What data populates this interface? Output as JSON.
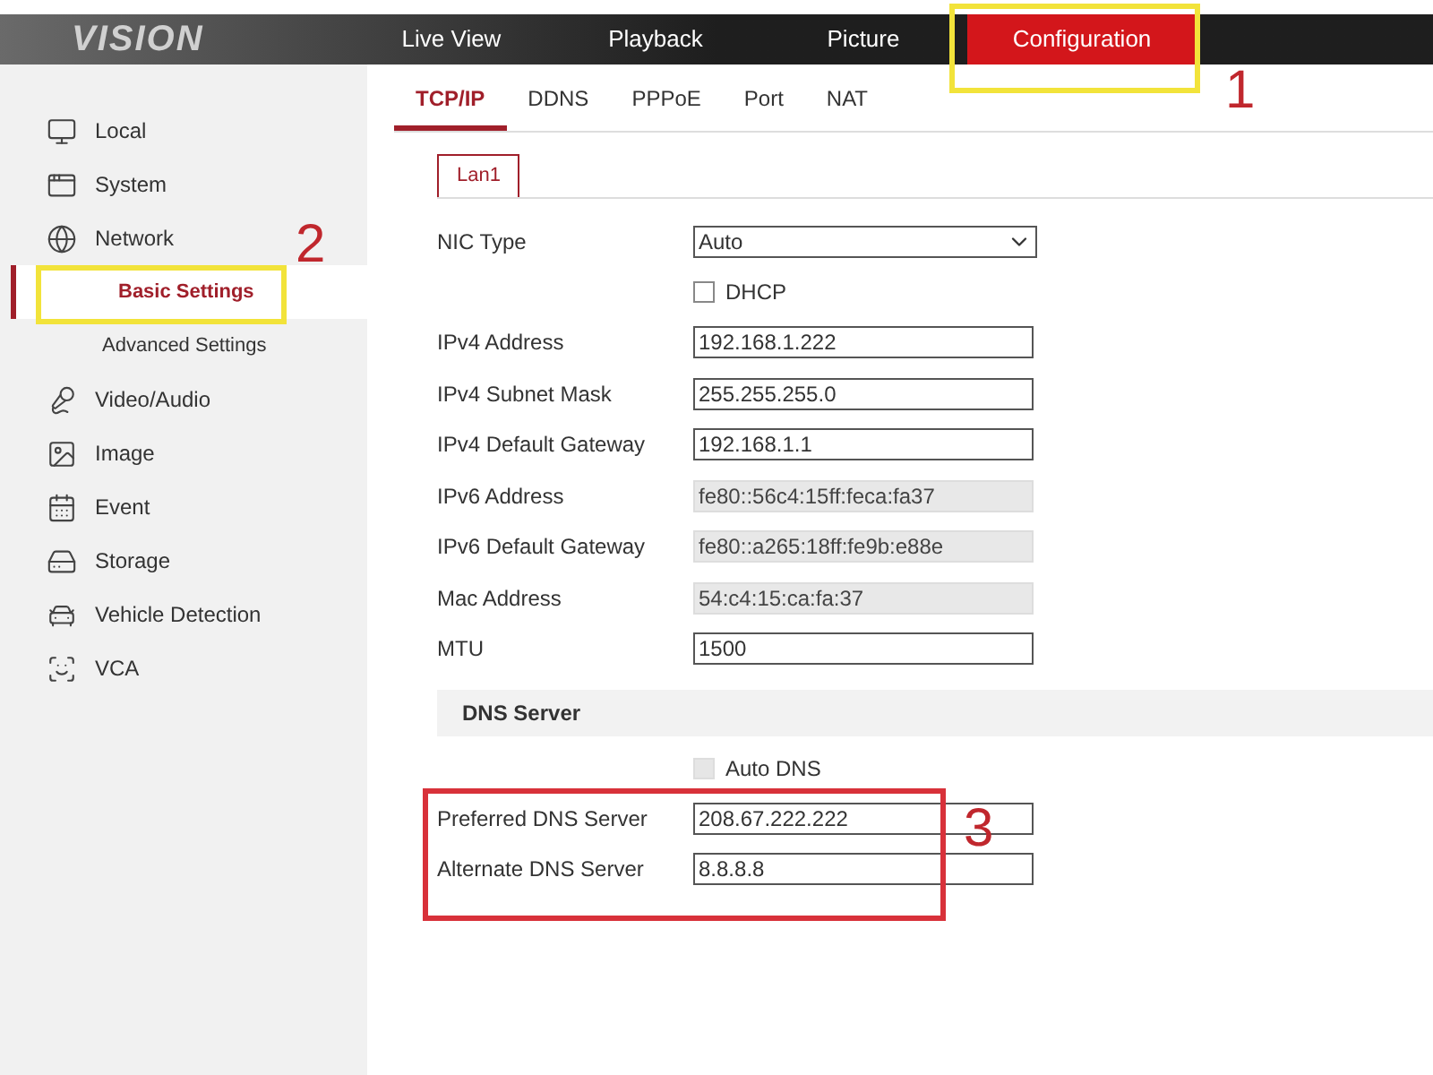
{
  "header": {
    "logo_text": "VISION",
    "nav": [
      {
        "label": "Live View",
        "selected": false
      },
      {
        "label": "Playback",
        "selected": false
      },
      {
        "label": "Picture",
        "selected": false
      },
      {
        "label": "Configuration",
        "selected": true
      }
    ]
  },
  "sidebar": {
    "items": [
      {
        "label": "Local",
        "selected": false
      },
      {
        "label": "System",
        "selected": false
      },
      {
        "label": "Network",
        "selected": false,
        "children": [
          {
            "label": "Basic Settings",
            "selected": true
          },
          {
            "label": "Advanced Settings",
            "selected": false
          }
        ]
      },
      {
        "label": "Video/Audio",
        "selected": false
      },
      {
        "label": "Image",
        "selected": false
      },
      {
        "label": "Event",
        "selected": false
      },
      {
        "label": "Storage",
        "selected": false
      },
      {
        "label": "Vehicle Detection",
        "selected": false
      },
      {
        "label": "VCA",
        "selected": false
      }
    ]
  },
  "tabs": [
    {
      "label": "TCP/IP",
      "selected": true
    },
    {
      "label": "DDNS",
      "selected": false
    },
    {
      "label": "PPPoE",
      "selected": false
    },
    {
      "label": "Port",
      "selected": false
    },
    {
      "label": "NAT",
      "selected": false
    }
  ],
  "subtabs": [
    {
      "label": "Lan1",
      "selected": true
    }
  ],
  "form": {
    "fields": [
      {
        "kind": "select",
        "label": "NIC Type",
        "value": "Auto"
      },
      {
        "kind": "checkbox",
        "label": "DHCP",
        "checked": false,
        "disabled": false
      },
      {
        "kind": "input",
        "label": "IPv4 Address",
        "value": "192.168.1.222",
        "disabled": false
      },
      {
        "kind": "input",
        "label": "IPv4 Subnet Mask",
        "value": "255.255.255.0",
        "disabled": false
      },
      {
        "kind": "input",
        "label": "IPv4 Default Gateway",
        "value": "192.168.1.1",
        "disabled": false
      },
      {
        "kind": "input",
        "label": "IPv6 Address",
        "value": "fe80::56c4:15ff:feca:fa37",
        "disabled": true
      },
      {
        "kind": "input",
        "label": "IPv6 Default Gateway",
        "value": "fe80::a265:18ff:fe9b:e88e",
        "disabled": true
      },
      {
        "kind": "input",
        "label": "Mac Address",
        "value": "54:c4:15:ca:fa:37",
        "disabled": true
      },
      {
        "kind": "input",
        "label": "MTU",
        "value": "1500",
        "disabled": false
      },
      {
        "kind": "section",
        "label": "DNS Server"
      },
      {
        "kind": "checkbox",
        "label": "Auto DNS",
        "checked": false,
        "disabled": true
      },
      {
        "kind": "input",
        "label": "Preferred DNS Server",
        "value": "208.67.222.222",
        "disabled": false
      },
      {
        "kind": "input",
        "label": "Alternate DNS Server",
        "value": "8.8.8.8",
        "disabled": false
      }
    ]
  },
  "annotations": [
    {
      "label": "1",
      "color": "#f2e33a"
    },
    {
      "label": "2",
      "color": "#f2e33a"
    },
    {
      "label": "3",
      "color": "#d8313a"
    }
  ]
}
